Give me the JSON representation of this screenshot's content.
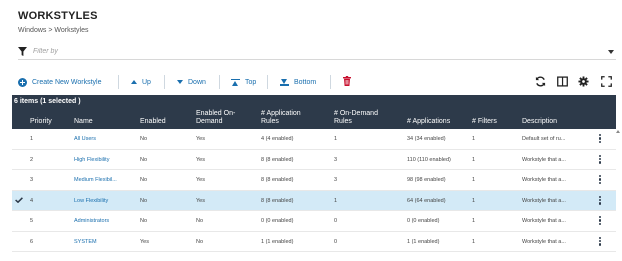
{
  "page": {
    "title": "WORKSTYLES",
    "breadcrumb": "Windows > Workstyles"
  },
  "filter": {
    "placeholder": "Filter by",
    "icon": "filter-icon"
  },
  "toolbar": {
    "create_label": "Create New Workstyle",
    "up_label": "Up",
    "down_label": "Down",
    "top_label": "Top",
    "bottom_label": "Bottom",
    "icons": [
      "plus-circle-icon",
      "arrow-up-icon",
      "arrow-down-icon",
      "to-top-icon",
      "to-bottom-icon",
      "trash-icon",
      "refresh-icon",
      "columns-icon",
      "settings-icon",
      "fullscreen-icon"
    ]
  },
  "grid": {
    "selection_summary": "6 items (1 selected )",
    "columns": [
      "Priority",
      "Name",
      "Enabled",
      "Enabled On-Demand",
      "# Application Rules",
      "# On-Demand Rules",
      "# Applications",
      "# Filters",
      "Description"
    ],
    "rows": [
      {
        "priority": "1",
        "name": "All Users",
        "enabled": "No",
        "on_demand": "Yes",
        "app_rules": "4 (4 enabled)",
        "od_rules": "1",
        "applications": "34 (34 enabled)",
        "filters": "1",
        "description": "Default set of ru...",
        "selected": false
      },
      {
        "priority": "2",
        "name": "High Flexibility",
        "enabled": "No",
        "on_demand": "Yes",
        "app_rules": "8 (8 enabled)",
        "od_rules": "3",
        "applications": "110 (110 enabled)",
        "filters": "1",
        "description": "Workstyle that a...",
        "selected": false
      },
      {
        "priority": "3",
        "name": "Medium Flexibil...",
        "enabled": "No",
        "on_demand": "Yes",
        "app_rules": "8 (8 enabled)",
        "od_rules": "3",
        "applications": "98 (98 enabled)",
        "filters": "1",
        "description": "Workstyle that a...",
        "selected": false
      },
      {
        "priority": "4",
        "name": "Low Flexibility",
        "enabled": "No",
        "on_demand": "Yes",
        "app_rules": "8 (8 enabled)",
        "od_rules": "1",
        "applications": "64 (64 enabled)",
        "filters": "1",
        "description": "Workstyle that a...",
        "selected": true
      },
      {
        "priority": "5",
        "name": "Administrators",
        "enabled": "No",
        "on_demand": "No",
        "app_rules": "0 (0 enabled)",
        "od_rules": "0",
        "applications": "0 (0 enabled)",
        "filters": "1",
        "description": "Workstyle that a...",
        "selected": false
      },
      {
        "priority": "6",
        "name": "SYSTEM",
        "enabled": "Yes",
        "on_demand": "No",
        "app_rules": "1 (1 enabled)",
        "od_rules": "0",
        "applications": "1 (1 enabled)",
        "filters": "1",
        "description": "Workstyle that a...",
        "selected": false
      }
    ]
  },
  "colors": {
    "accent": "#1a6fae",
    "header_bg": "#2d3a4a",
    "selected_row": "#d3eaf7",
    "danger": "#c8102e"
  }
}
